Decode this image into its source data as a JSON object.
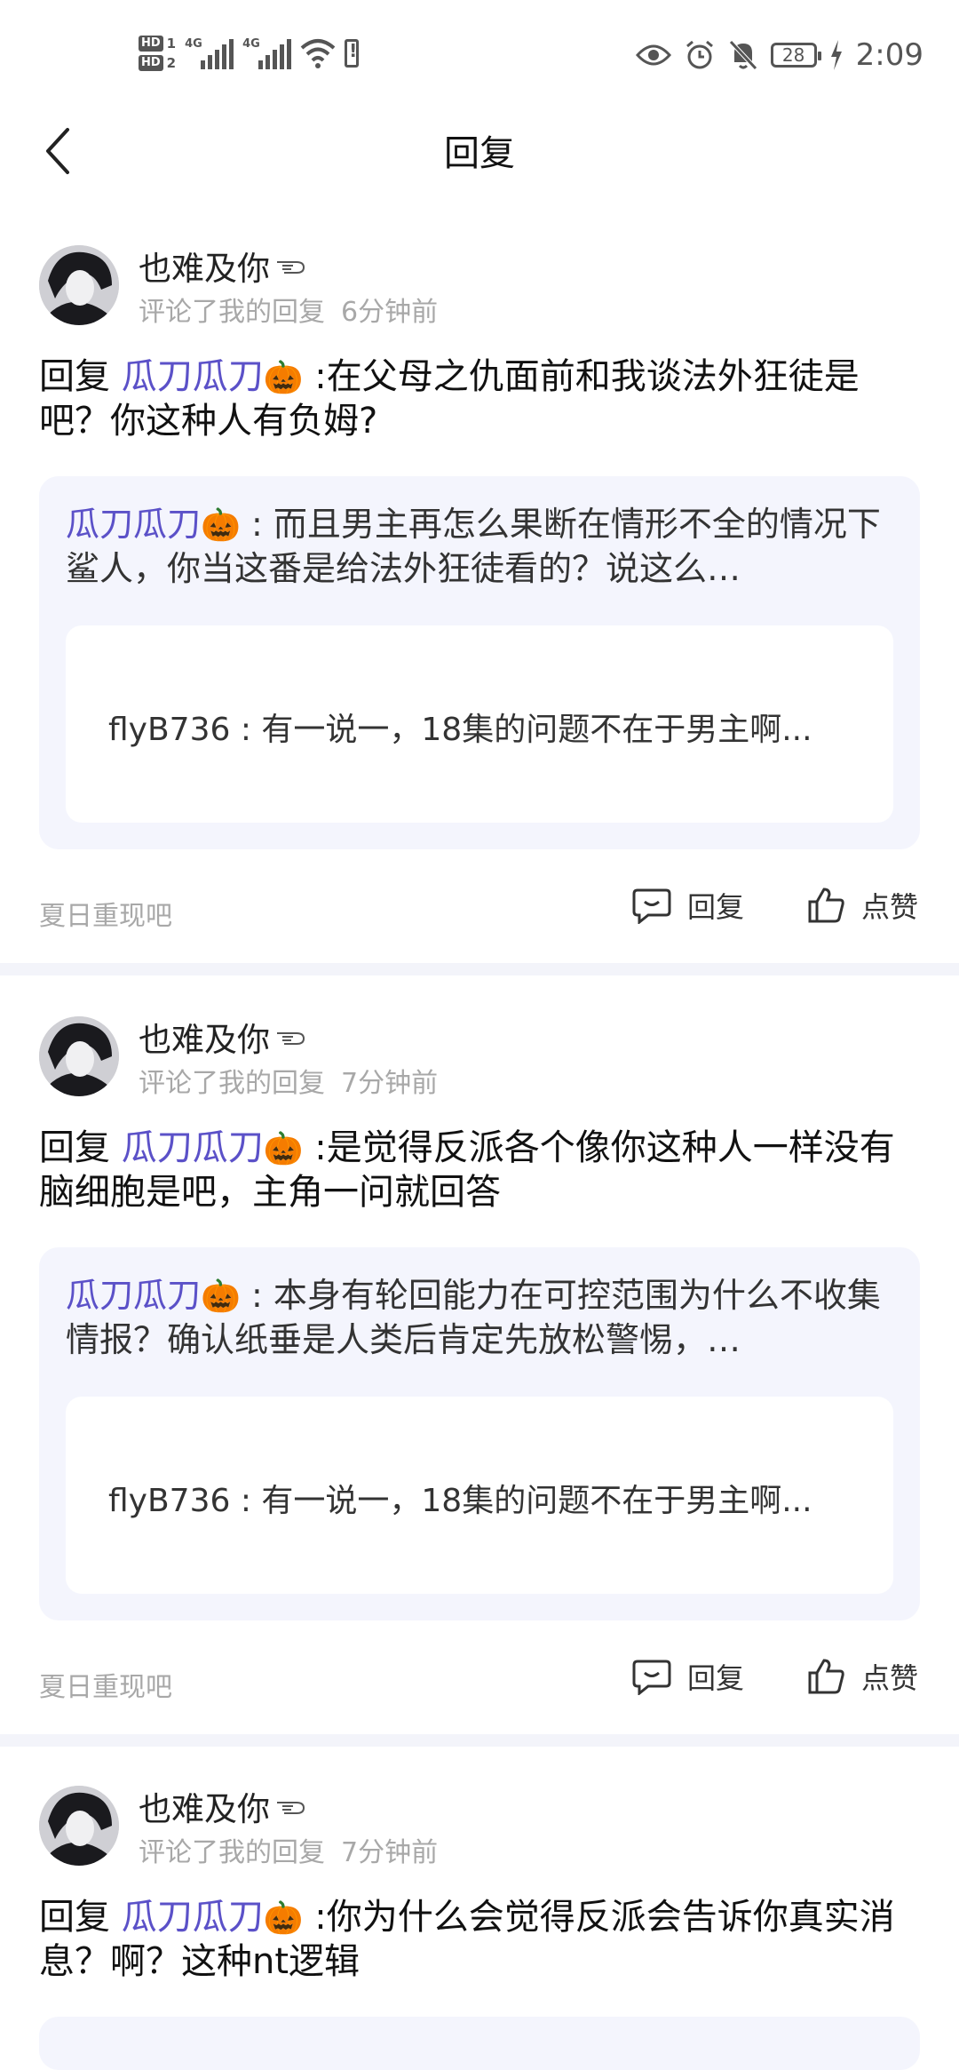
{
  "status_bar": {
    "time": "2:09",
    "battery": "28",
    "sim1": "HD",
    "sim1_num": "1",
    "sim2": "HD",
    "sim2_num": "2",
    "net1": "4G",
    "net2": "4G"
  },
  "header": {
    "title": "回复"
  },
  "items": [
    {
      "user": "也难及你",
      "action": "评论了我的回复",
      "time": "6分钟前",
      "reply_prefix": "回复",
      "mention": "瓜刀瓜刀",
      "emoji": "🎃",
      "reply_text": ":在父母之仇面前和我谈法外狂徒是吧？你这种人有负姆?",
      "quote_user": "瓜刀瓜刀",
      "quote_emoji": "🎃",
      "quote_text": ": 而且男主再怎么果断在情形不全的情况下鲨人，你当这番是给法外狂徒看的？说这么…",
      "inner_text": "flyB736 : 有一说一，18集的问题不在于男主啊...",
      "work": "夏日重现吧",
      "reply_label": "回复",
      "like_label": "点赞"
    },
    {
      "user": "也难及你",
      "action": "评论了我的回复",
      "time": "7分钟前",
      "reply_prefix": "回复",
      "mention": "瓜刀瓜刀",
      "emoji": "🎃",
      "reply_text": ":是觉得反派各个像你这种人一样没有脑细胞是吧，主角一问就回答",
      "quote_user": "瓜刀瓜刀",
      "quote_emoji": "🎃",
      "quote_text": ": 本身有轮回能力在可控范围为什么不收集情报？确认纸垂是人类后肯定先放松警惕，…",
      "inner_text": "flyB736 : 有一说一，18集的问题不在于男主啊...",
      "work": "夏日重现吧",
      "reply_label": "回复",
      "like_label": "点赞"
    },
    {
      "user": "也难及你",
      "action": "评论了我的回复",
      "time": "7分钟前",
      "reply_prefix": "回复",
      "mention": "瓜刀瓜刀",
      "emoji": "🎃",
      "reply_text": ":你为什么会觉得反派会告诉你真实消息？啊？这种nt逻辑"
    }
  ]
}
